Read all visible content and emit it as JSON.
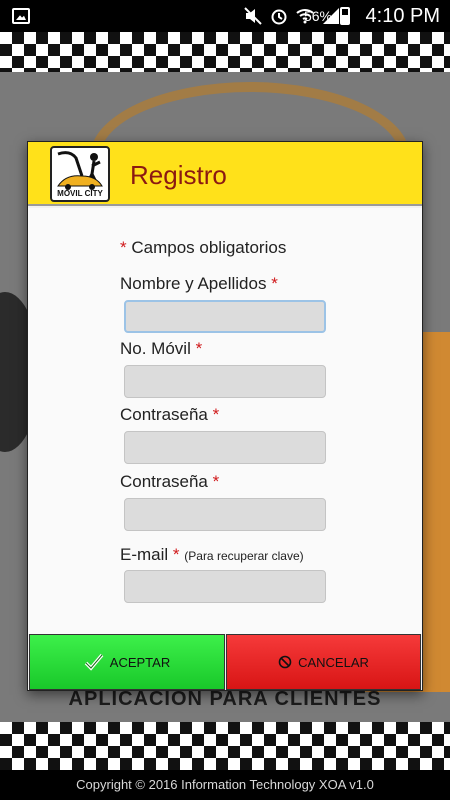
{
  "status_bar": {
    "battery_percent": "56%",
    "time": "4:10 PM",
    "icons": [
      "image-icon",
      "mute-icon",
      "alarm-icon",
      "wifi-icon",
      "signal-icon",
      "battery-icon"
    ]
  },
  "dialog": {
    "title": "Registro",
    "logo_text": "MÓVIL CITY",
    "required_mark": "*",
    "required_note": "Campos obligatorios",
    "fields": [
      {
        "label": "Nombre y Apellidos",
        "required": "*",
        "hint": "",
        "value": ""
      },
      {
        "label": "No. Móvil",
        "required": "*",
        "hint": "",
        "value": ""
      },
      {
        "label": "Contraseña",
        "required": "*",
        "hint": "",
        "value": ""
      },
      {
        "label": "Contraseña",
        "required": "*",
        "hint": "",
        "value": ""
      },
      {
        "label": "E-mail",
        "required": "*",
        "hint": "(Para recuperar clave)",
        "value": ""
      }
    ],
    "accept_label": "ACEPTAR",
    "cancel_label": "CANCELAR"
  },
  "background": {
    "tagline": "APLICACIÓN PARA CLIENTES"
  },
  "footer": {
    "copyright": "Copyright © 2016 Information Technology XOA v1.0"
  },
  "colors": {
    "header_yellow": "#ffe11a",
    "title_red": "#8b1a12",
    "accept_green": "#2bdc3a",
    "cancel_red": "#e82424"
  }
}
